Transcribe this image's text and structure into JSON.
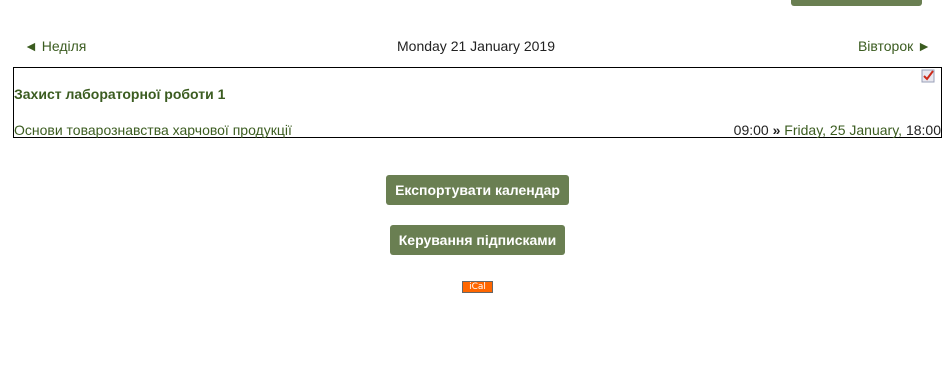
{
  "navigation": {
    "prev_day": "◄ Неділя",
    "current_date": "Monday 21 January 2019",
    "next_day": "Вівторок ►"
  },
  "event": {
    "title": "Захист лабораторної роботи 1",
    "course": "Основи товарознавства харчової продукції",
    "start_time": "09:00",
    "separator": "»",
    "end_date": "Friday, 25 January,",
    "end_time": "18:00",
    "icon": "edit-checkmark-icon"
  },
  "buttons": {
    "export_calendar": "Експортувати календар",
    "manage_subscriptions": "Керування підписками"
  },
  "ical_badge": "iCal",
  "colors": {
    "accent": "#6a7f52",
    "link": "#3b5c20",
    "ical": "#ff6600"
  }
}
